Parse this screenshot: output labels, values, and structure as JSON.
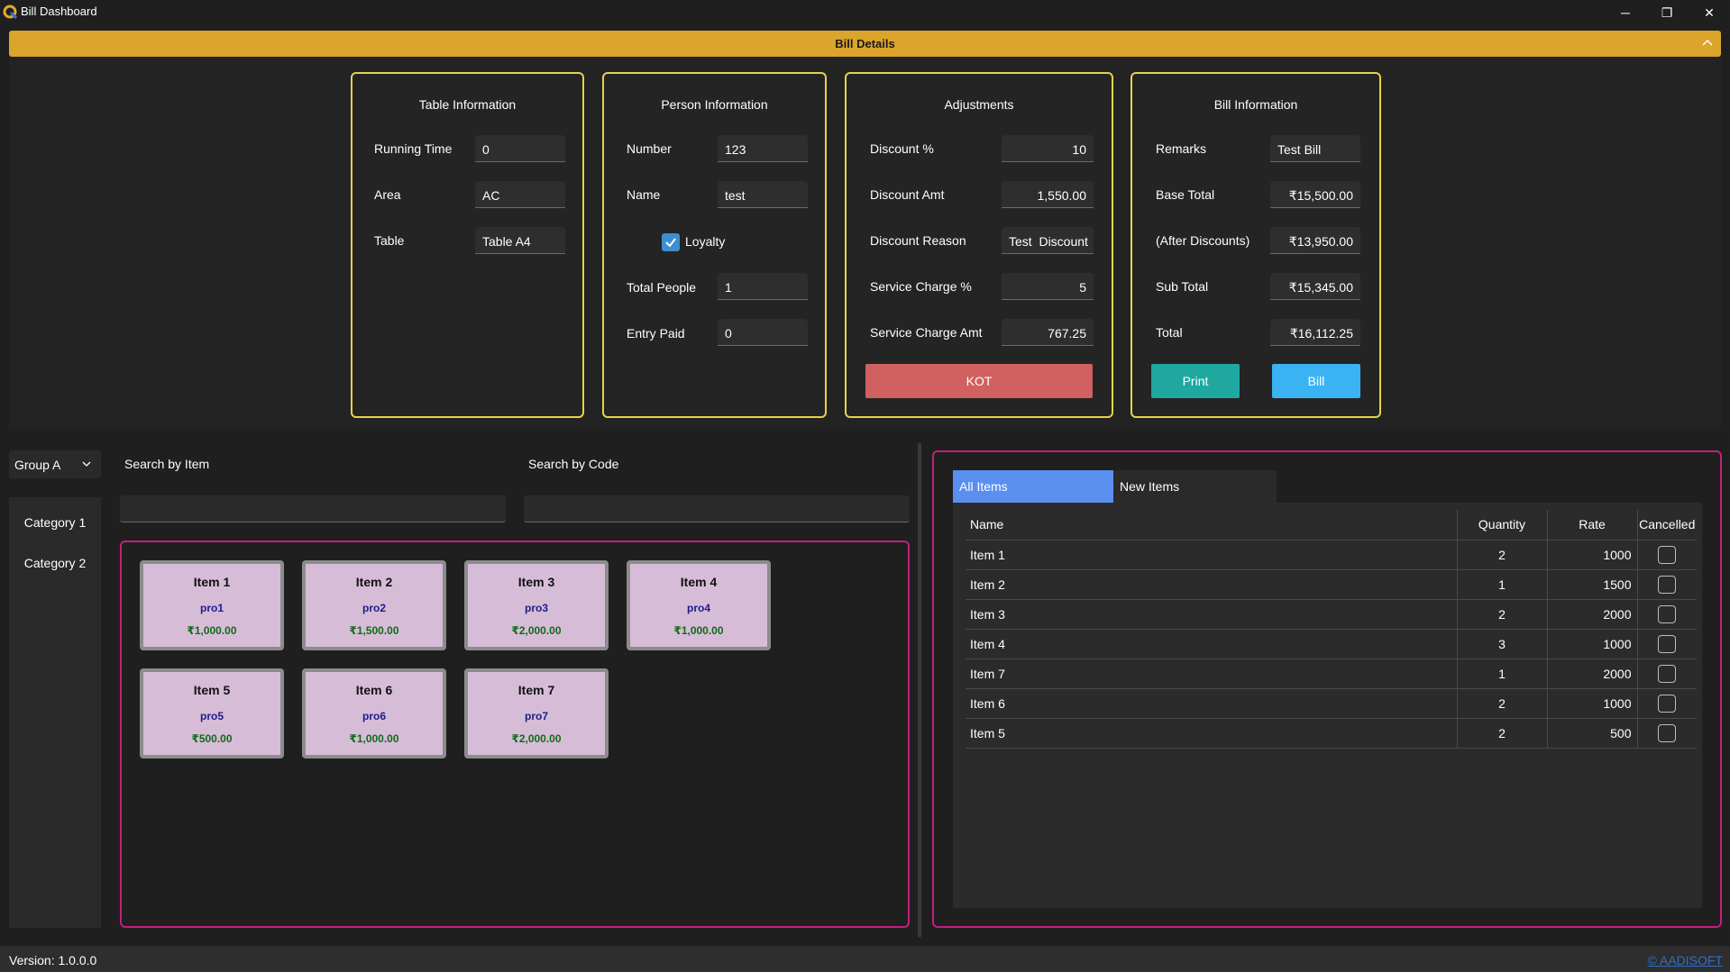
{
  "window": {
    "title": "Bill Dashboard",
    "controls": {
      "minimize": "─",
      "restore": "❐",
      "close": "✕"
    }
  },
  "header": {
    "title": "Bill Details",
    "accent_color": "#dba42a"
  },
  "table_info": {
    "title": "Table Information",
    "running_time_label": "Running Time",
    "running_time": "0",
    "area_label": "Area",
    "area": "AC",
    "table_label": "Table",
    "table": "Table A4"
  },
  "person_info": {
    "title": "Person Information",
    "number_label": "Number",
    "number": "123",
    "name_label": "Name",
    "name": "test",
    "loyalty_label": "Loyalty",
    "loyalty_checked": true,
    "total_people_label": "Total People",
    "total_people": "1",
    "entry_paid_label": "Entry Paid",
    "entry_paid": "0"
  },
  "adjustments": {
    "title": "Adjustments",
    "discount_pct_label": "Discount %",
    "discount_pct": "10",
    "discount_amt_label": "Discount Amt",
    "discount_amt": "1,550.00",
    "discount_reason_label": "Discount Reason",
    "discount_reason": "Test  Discount",
    "service_charge_pct_label": "Service Charge %",
    "service_charge_pct": "5",
    "service_charge_amt_label": "Service Charge Amt",
    "service_charge_amt": "767.25",
    "kot_label": "KOT"
  },
  "bill_info": {
    "title": "Bill Information",
    "remarks_label": "Remarks",
    "remarks": "Test Bill",
    "base_total_label": "Base Total",
    "base_total": "₹15,500.00",
    "after_discounts_label": "(After Discounts)",
    "after_discounts": "₹13,950.00",
    "sub_total_label": "Sub Total",
    "sub_total": "₹15,345.00",
    "total_label": "Total",
    "total": "₹16,112.25",
    "print_label": "Print",
    "bill_label": "Bill"
  },
  "colors": {
    "panel_border": "#e6d24a",
    "kot": "#d16060",
    "print": "#1fa8a0",
    "bill": "#3bb3f2",
    "grid_border": "#c41f7e",
    "item_card": "#d7bcd7",
    "active_tab": "#5a8ff0"
  },
  "group_select": {
    "value": "Group A"
  },
  "categories": [
    "Category 1",
    "Category 2"
  ],
  "search": {
    "by_item_label": "Search by Item",
    "by_code_label": "Search by Code",
    "by_item_value": "",
    "by_code_value": ""
  },
  "items": [
    {
      "name": "Item 1",
      "code": "pro1",
      "price": "₹1,000.00"
    },
    {
      "name": "Item 2",
      "code": "pro2",
      "price": "₹1,500.00"
    },
    {
      "name": "Item 3",
      "code": "pro3",
      "price": "₹2,000.00"
    },
    {
      "name": "Item 4",
      "code": "pro4",
      "price": "₹1,000.00"
    },
    {
      "name": "Item 5",
      "code": "pro5",
      "price": "₹500.00"
    },
    {
      "name": "Item 6",
      "code": "pro6",
      "price": "₹1,000.00"
    },
    {
      "name": "Item 7",
      "code": "pro7",
      "price": "₹2,000.00"
    }
  ],
  "tabs": [
    {
      "label": "All Items",
      "active": true
    },
    {
      "label": "New Items",
      "active": false
    }
  ],
  "order_table": {
    "columns": [
      "Name",
      "Quantity",
      "Rate",
      "Cancelled"
    ],
    "rows": [
      {
        "name": "Item 1",
        "quantity": "2",
        "rate": "1000",
        "cancelled": false
      },
      {
        "name": "Item 2",
        "quantity": "1",
        "rate": "1500",
        "cancelled": false
      },
      {
        "name": "Item 3",
        "quantity": "2",
        "rate": "2000",
        "cancelled": false
      },
      {
        "name": "Item 4",
        "quantity": "3",
        "rate": "1000",
        "cancelled": false
      },
      {
        "name": "Item 7",
        "quantity": "1",
        "rate": "2000",
        "cancelled": false
      },
      {
        "name": "Item 6",
        "quantity": "2",
        "rate": "1000",
        "cancelled": false
      },
      {
        "name": "Item 5",
        "quantity": "2",
        "rate": "500",
        "cancelled": false
      }
    ]
  },
  "footer": {
    "version": "Version: 1.0.0.0",
    "copyright": "© AADISOFT"
  }
}
